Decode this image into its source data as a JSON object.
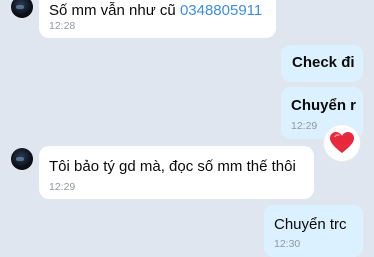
{
  "messages": [
    {
      "id": "m1",
      "side": "in",
      "text_prefix": "Số mm vẫn như cũ ",
      "phone": "0348805911",
      "time": "12:28"
    },
    {
      "id": "m2",
      "side": "out",
      "text": "Check đi"
    },
    {
      "id": "m3",
      "side": "out",
      "text": "Chuyển r",
      "time": "12:29",
      "reaction": "heart"
    },
    {
      "id": "m4",
      "side": "in",
      "text": "Tôi bảo tý gd mà, đọc số mm thế thôi",
      "time": "12:29"
    },
    {
      "id": "m5",
      "side": "out",
      "text": "Chuyển trc",
      "time": "12:30"
    }
  ],
  "colors": {
    "background": "#dfe6ef",
    "incoming_bubble": "#ffffff",
    "outgoing_bubble": "#dcf1ff",
    "link": "#3d8de0",
    "timestamp": "#8f98a3",
    "heart": "#e8293b"
  },
  "icons": {
    "reaction": "heart-icon",
    "avatar": "sender-avatar"
  }
}
